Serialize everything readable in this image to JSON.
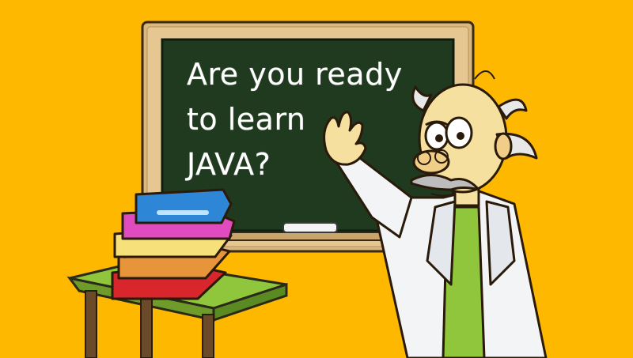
{
  "colors": {
    "background": "#FFB800",
    "board": "#1F3A1F",
    "frame": "#D9B77E",
    "chalk_text": "#FFFFFF"
  },
  "chalkboard": {
    "lines": [
      "Are you ready",
      "to learn",
      "JAVA?"
    ]
  },
  "illustration": {
    "figures": [
      "professor-character",
      "stack-of-books",
      "school-desk",
      "chalk-piece"
    ]
  }
}
